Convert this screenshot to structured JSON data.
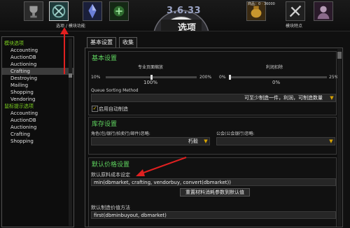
{
  "header": {
    "version": "3.6.33",
    "title": "选项",
    "icons": [
      {
        "name": "trophy-icon",
        "label": ""
      },
      {
        "name": "options-module-icon",
        "label": "选项 / 模块功能"
      },
      {
        "name": "crystal-icon",
        "label": ""
      },
      {
        "name": "green-emblem-icon",
        "label": ""
      },
      {
        "name": "gold-bag-icon",
        "label": "商品：0 · 36000"
      },
      {
        "name": "module-features-icon",
        "label": "模块特点"
      },
      {
        "name": "portrait-icon",
        "label": ""
      }
    ]
  },
  "sidebar": {
    "group1": "模块选项",
    "group1_items": [
      "Accounting",
      "AuctionDB",
      "Auctioning",
      "Crafting",
      "Destroying",
      "Mailing",
      "Shopping",
      "Vendoring"
    ],
    "group2": "鼠标提示选项",
    "group2_items": [
      "Accounting",
      "AuctionDB",
      "Auctioning",
      "Crafting",
      "Shopping"
    ]
  },
  "tabs": [
    "基本设置",
    "收集"
  ],
  "basic": {
    "title": "基本设置",
    "zoom_label": "专业页面缩放",
    "zoom_min": "10%",
    "zoom_value": "100%",
    "zoom_max": "200%",
    "zoom_level": 0.5,
    "profit_label": "利润扣除",
    "profit_min": "0%",
    "profit_value": "0%",
    "profit_max": "25%",
    "profit_level": 0.0,
    "queue_label": "Queue Sorting Method",
    "queue_value": "可至少制造一件，利润，可制造数量",
    "autocraft_label": "启用自动制造",
    "autocraft_checked": "✓"
  },
  "inventory": {
    "title": "库存设置",
    "left_label": "角色(包/银行/拍卖行/邮件)忽略:",
    "left_value": "朽毅",
    "right_label": "公会(公会银行)忽略:",
    "right_value": ""
  },
  "price": {
    "title": "默认价格设置",
    "mat_label": "默认原料成本设定",
    "mat_value": "min(dbmarket, crafting, vendorbuy, convert(dbmarket))",
    "reset_button": "重置材料消耗参数到默认值",
    "craft_label": "默认制造价值方法",
    "craft_value": "first(dbminbuyout, dbmarket)"
  },
  "colors": {
    "accent_green": "#7ed321",
    "arrow_red": "#e02020",
    "dropdown_gold": "#d9a400"
  }
}
